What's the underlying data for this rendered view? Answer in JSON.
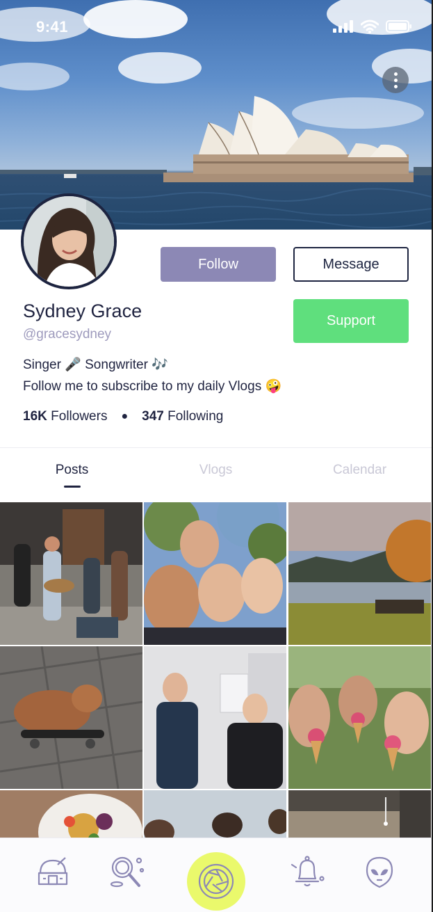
{
  "status_bar": {
    "time": "9:41",
    "icons": [
      "signal-icon",
      "wifi-icon",
      "battery-icon"
    ]
  },
  "header": {
    "more_icon": "more-vertical-icon"
  },
  "profile": {
    "name": "Sydney Grace",
    "handle": "@gracesydney",
    "bio_line_1": "Singer 🎤 Songwriter 🎶",
    "bio_line_2": "Follow me to subscribe to my daily Vlogs 🤪",
    "followers_count": "16K",
    "followers_label": "Followers",
    "following_count": "347",
    "following_label": "Following"
  },
  "actions": {
    "follow_label": "Follow",
    "message_label": "Message",
    "support_label": "Support"
  },
  "tabs": [
    {
      "label": "Posts",
      "active": true
    },
    {
      "label": "Vlogs",
      "active": false
    },
    {
      "label": "Calendar",
      "active": false
    }
  ],
  "grid": {
    "photos": [
      "street-musicians-photo",
      "friends-selfie-photo",
      "lakeside-sunset-photo",
      "skateboarding-bulldog-photo",
      "office-friends-photo",
      "ice-cream-friends-photo",
      "food-plate-photo",
      "group-outdoors-photo",
      "interior-room-photo"
    ]
  },
  "bottom_nav": {
    "items": [
      "observatory-icon",
      "explore-icon",
      "camera-icon",
      "notifications-icon",
      "alien-profile-icon"
    ],
    "active_item": "camera-icon"
  },
  "colors": {
    "follow_button": "#8c88b5",
    "support_button": "#5fdf7d",
    "camera_highlight": "#eaf96c",
    "primary_text": "#1f2340",
    "handle_text": "#9e9bbd",
    "inactive_tab": "#c9c8d6"
  }
}
